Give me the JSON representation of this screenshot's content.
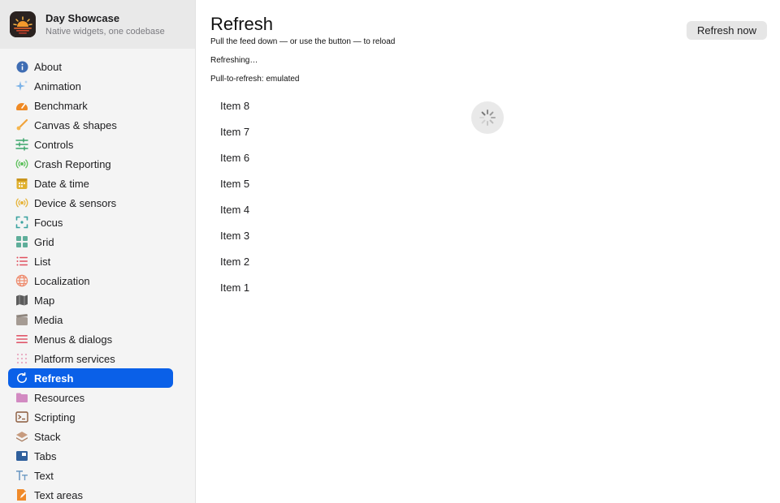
{
  "app": {
    "title": "Day Showcase",
    "subtitle": "Native widgets, one codebase",
    "logo_icon": "sunset-logo-icon"
  },
  "sidebar": {
    "active_color": "#0a60e8",
    "items": [
      {
        "label": "About",
        "icon": "info-icon"
      },
      {
        "label": "Animation",
        "icon": "sparkles-icon"
      },
      {
        "label": "Benchmark",
        "icon": "gauge-icon"
      },
      {
        "label": "Canvas & shapes",
        "icon": "paintbrush-icon"
      },
      {
        "label": "Controls",
        "icon": "sliders-icon"
      },
      {
        "label": "Crash Reporting",
        "icon": "broadcast-icon"
      },
      {
        "label": "Date & time",
        "icon": "calendar-icon"
      },
      {
        "label": "Device & sensors",
        "icon": "sensor-icon"
      },
      {
        "label": "Focus",
        "icon": "focus-icon"
      },
      {
        "label": "Grid",
        "icon": "grid-icon"
      },
      {
        "label": "List",
        "icon": "list-icon"
      },
      {
        "label": "Localization",
        "icon": "globe-icon"
      },
      {
        "label": "Map",
        "icon": "map-icon"
      },
      {
        "label": "Media",
        "icon": "clapperboard-icon"
      },
      {
        "label": "Menus & dialogs",
        "icon": "menu-icon"
      },
      {
        "label": "Platform services",
        "icon": "dots-grid-icon"
      },
      {
        "label": "Refresh",
        "icon": "refresh-icon",
        "active": true
      },
      {
        "label": "Resources",
        "icon": "folder-icon"
      },
      {
        "label": "Scripting",
        "icon": "terminal-icon"
      },
      {
        "label": "Stack",
        "icon": "layers-icon"
      },
      {
        "label": "Tabs",
        "icon": "tabs-icon"
      },
      {
        "label": "Text",
        "icon": "text-icon"
      },
      {
        "label": "Text areas",
        "icon": "document-edit-icon"
      }
    ]
  },
  "main": {
    "title": "Refresh",
    "subtitle": "Pull the feed down — or use the button — to reload",
    "status": "Refreshing…",
    "mode": "Pull-to-refresh: emulated",
    "refresh_button": "Refresh now",
    "spinner_icon": "activity-spinner-icon",
    "feed": [
      "Item 8",
      "Item 7",
      "Item 6",
      "Item 5",
      "Item 4",
      "Item 3",
      "Item 2",
      "Item 1"
    ]
  }
}
